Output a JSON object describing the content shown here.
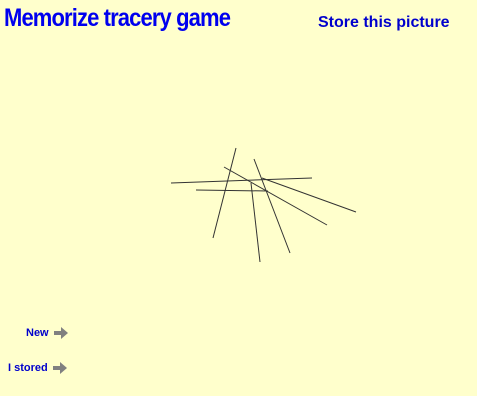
{
  "header": {
    "title": "Memorize tracery game",
    "instruction": "Store this picture"
  },
  "controls": {
    "new_label": "New",
    "stored_label": "I stored",
    "arrow_icon": "right-arrow-icon",
    "arrow_color": "#808080"
  },
  "colors": {
    "background": "#ffffcc",
    "title": "#0000ee",
    "text": "#0000cc",
    "stroke": "#333333"
  }
}
